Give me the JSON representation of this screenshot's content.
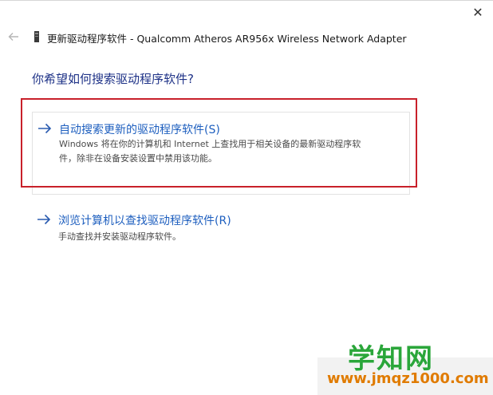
{
  "window": {
    "close_glyph": "✕"
  },
  "header": {
    "title": "更新驱动程序软件 - Qualcomm Atheros AR956x Wireless Network Adapter"
  },
  "question": "你希望如何搜索驱动程序软件?",
  "options": [
    {
      "title": "自动搜索更新的驱动程序软件(S)",
      "desc_line1": "Windows 将在你的计算机和 Internet 上查找用于相关设备的最新驱动程序软",
      "desc_line2": "件，除非在设备安装设置中禁用该功能。"
    },
    {
      "title": "浏览计算机以查找驱动程序软件(R)",
      "desc_line1": "手动查找并安装驱动程序软件。"
    }
  ],
  "watermark": {
    "main": "学知网",
    "url": "www.jmqz1000.com"
  },
  "colors": {
    "link": "#1e5fbf",
    "question": "#1e3287",
    "highlight": "#c8202a",
    "watermark_green": "#2aa63a",
    "watermark_orange": "#e07b00"
  }
}
